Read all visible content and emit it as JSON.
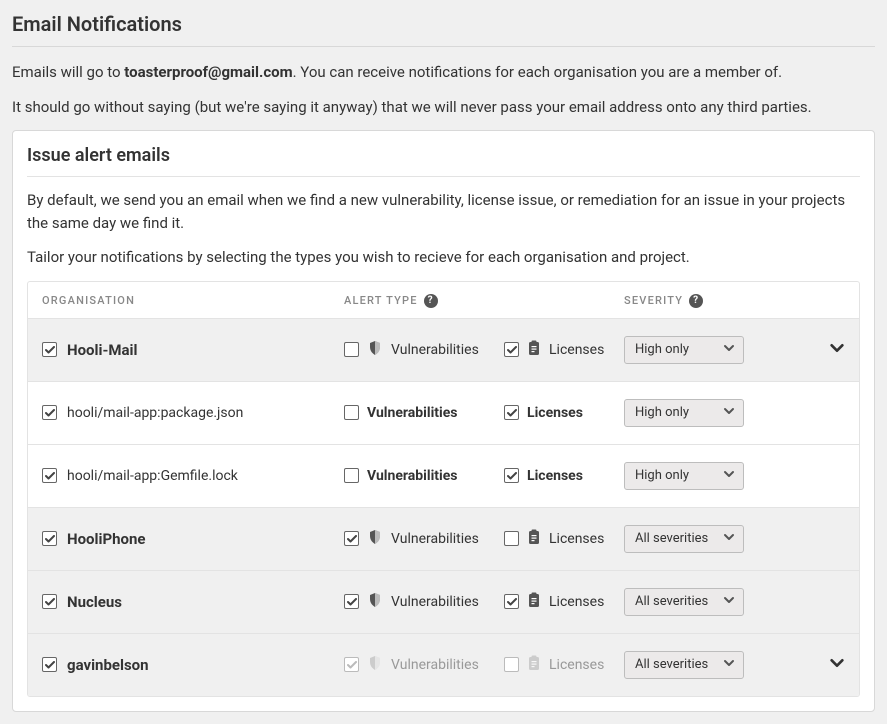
{
  "title": "Email Notifications",
  "intro_prefix": "Emails will go to ",
  "email": "toasterproof@gmail.com",
  "intro_suffix": ". You can receive notifications for each organisation you are a member of.",
  "privacy": "It should go without saying (but we're saying it anyway) that we will never pass your email address onto any third parties.",
  "panel": {
    "title": "Issue alert emails",
    "desc1": "By default, we send you an email when we find a new vulnerability, license issue, or remediation for an issue in your projects the same day we find it.",
    "desc2": "Tailor your notifications by selecting the types you wish to recieve for each organisation and project."
  },
  "headers": {
    "org": "ORGANISATION",
    "alert": "ALERT TYPE",
    "sev": "SEVERITY"
  },
  "labels": {
    "vuln": "Vulnerabilities",
    "lic": "Licenses"
  },
  "severity_options": {
    "high": "High only",
    "all": "All severities"
  },
  "rows": [
    {
      "id": "hooli-mail",
      "shaded": true,
      "kind": "org",
      "name": "Hooli-Mail",
      "checked": true,
      "vuln_checked": false,
      "lic_checked": true,
      "sev": "High only",
      "expand": true,
      "bold_labels": false,
      "dim": false
    },
    {
      "id": "proj-package",
      "shaded": false,
      "kind": "proj",
      "name": "hooli/mail-app:package.json",
      "checked": true,
      "vuln_checked": false,
      "lic_checked": true,
      "sev": "High only",
      "expand": false,
      "bold_labels": true,
      "dim": false
    },
    {
      "id": "proj-gemfile",
      "shaded": false,
      "kind": "proj",
      "name": "hooli/mail-app:Gemfile.lock",
      "checked": true,
      "vuln_checked": false,
      "lic_checked": true,
      "sev": "High only",
      "expand": false,
      "bold_labels": true,
      "dim": false
    },
    {
      "id": "hooliphone",
      "shaded": true,
      "kind": "org",
      "name": "HooliPhone",
      "checked": true,
      "vuln_checked": true,
      "lic_checked": false,
      "sev": "All severities",
      "expand": false,
      "bold_labels": false,
      "dim": false
    },
    {
      "id": "nucleus",
      "shaded": true,
      "kind": "org",
      "name": "Nucleus",
      "checked": true,
      "vuln_checked": true,
      "lic_checked": true,
      "sev": "All severities",
      "expand": false,
      "bold_labels": false,
      "dim": false
    },
    {
      "id": "gavinbelson",
      "shaded": true,
      "kind": "org",
      "name": "gavinbelson",
      "checked": true,
      "vuln_checked": true,
      "lic_checked": false,
      "sev": "All severities",
      "expand": true,
      "bold_labels": false,
      "dim": true
    }
  ]
}
